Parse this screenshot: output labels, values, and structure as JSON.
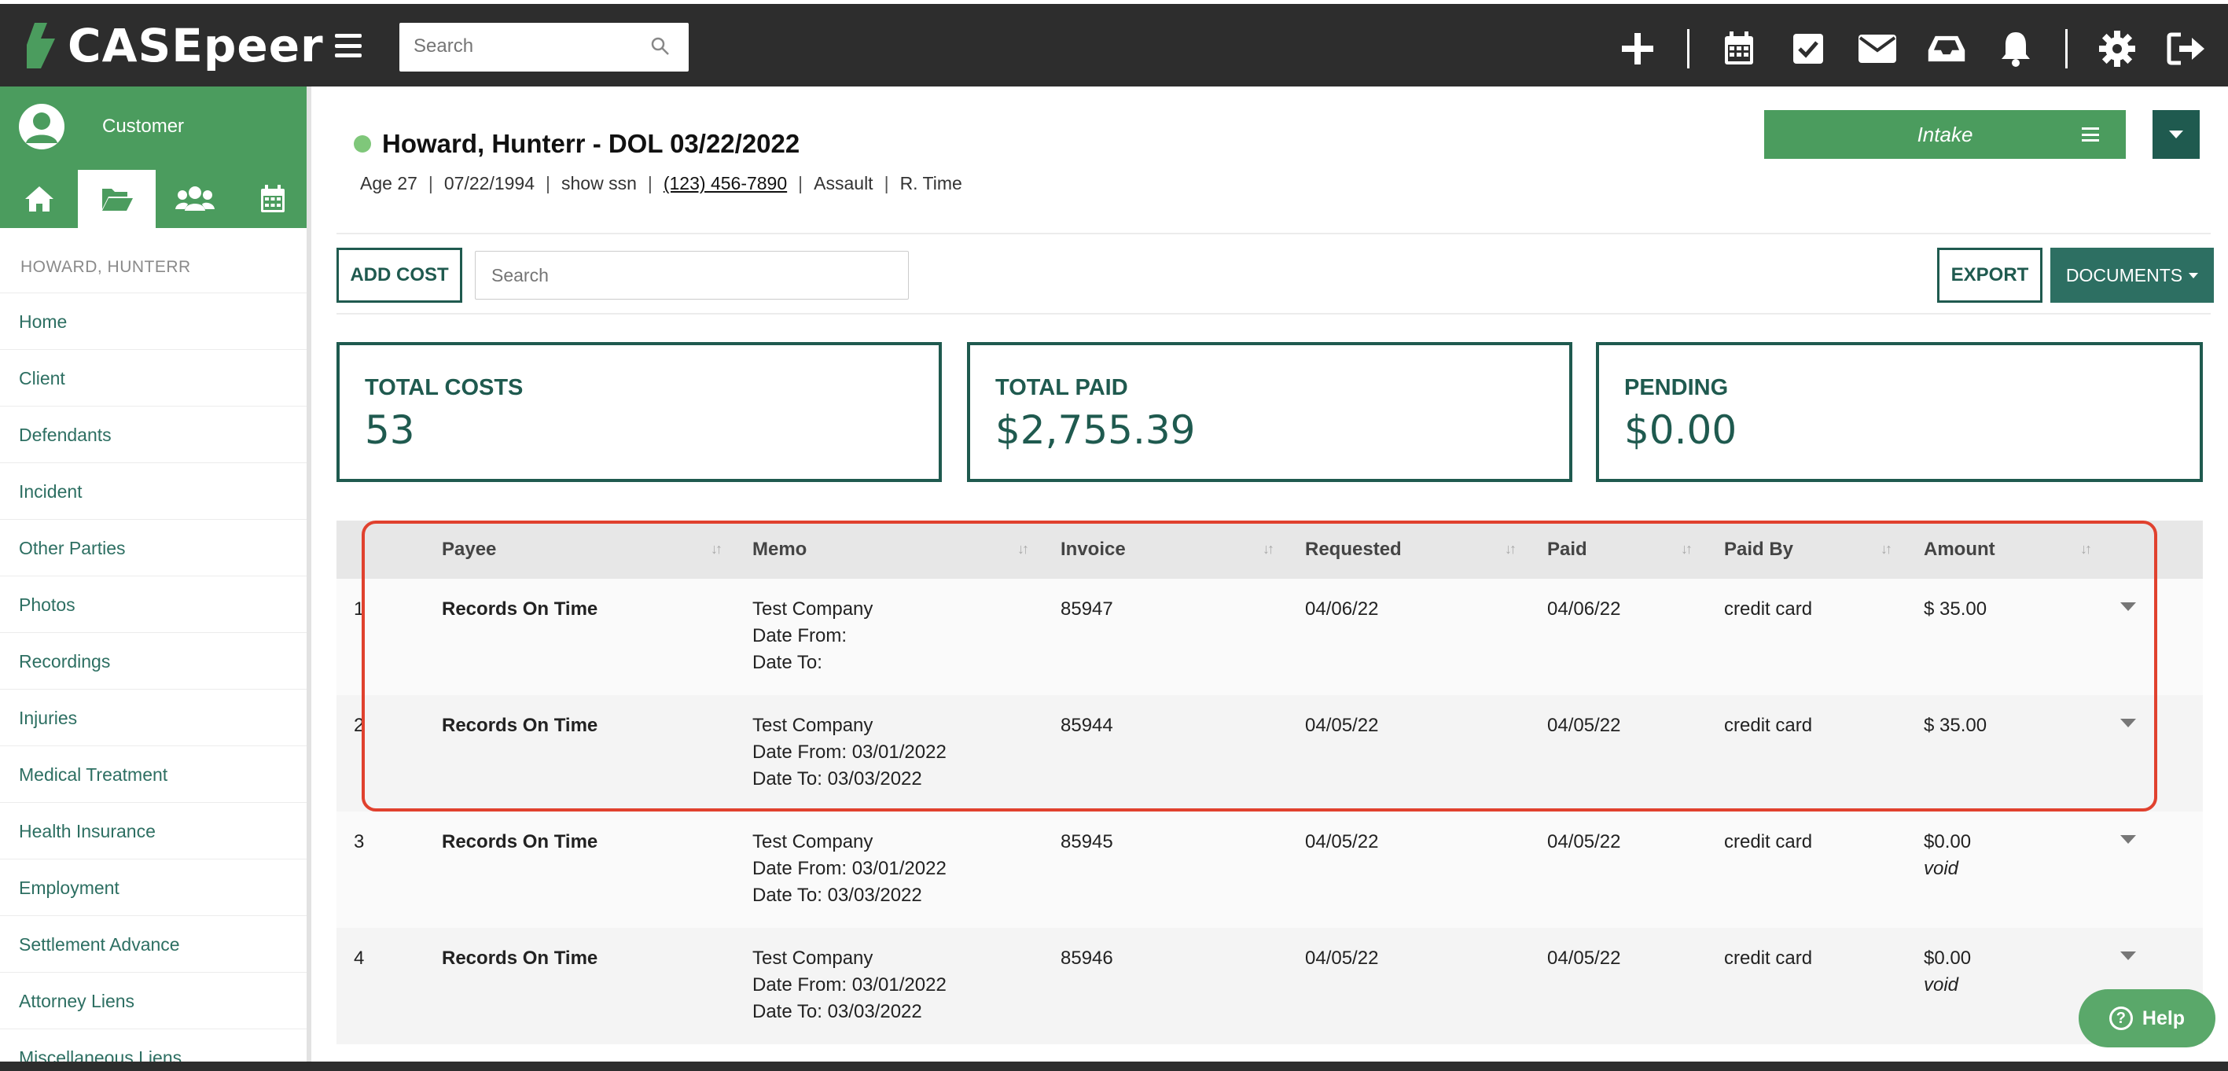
{
  "app": {
    "logo_text": "CASEpeer",
    "search_placeholder": "Search"
  },
  "topbar": {
    "icons": [
      "plus-icon",
      "calendar-icon",
      "checkbox-icon",
      "mail-icon",
      "inbox-icon",
      "bell-icon",
      "gear-icon",
      "logout-icon"
    ]
  },
  "sidebar": {
    "user_name": "Customer",
    "tabs": [
      "home-icon",
      "folder-open-icon",
      "users-icon",
      "calendar-icon"
    ],
    "case_name": "HOWARD, HUNTERR",
    "items": [
      {
        "label": "Home"
      },
      {
        "label": "Client"
      },
      {
        "label": "Defendants"
      },
      {
        "label": "Incident"
      },
      {
        "label": "Other Parties"
      },
      {
        "label": "Photos"
      },
      {
        "label": "Recordings"
      },
      {
        "label": "Injuries"
      },
      {
        "label": "Medical Treatment"
      },
      {
        "label": "Health Insurance"
      },
      {
        "label": "Employment"
      },
      {
        "label": "Settlement Advance"
      },
      {
        "label": "Attorney Liens"
      },
      {
        "label": "Miscellaneous Liens"
      }
    ]
  },
  "case": {
    "title": "Howard, Hunterr - DOL 03/22/2022",
    "status_color": "#7fc77a",
    "age": "Age 27",
    "dob": "07/22/1994",
    "ssn_link": "show ssn",
    "phone": "(123) 456-7890",
    "case_type": "Assault",
    "attorney": "R. Time"
  },
  "stage": {
    "label": "Intake"
  },
  "toolbar": {
    "add_cost_label": "ADD COST",
    "search_placeholder": "Search",
    "export_label": "EXPORT",
    "documents_label": "DOCUMENTS"
  },
  "stats": {
    "total_costs_label": "TOTAL COSTS",
    "total_costs_value": "53",
    "total_paid_label": "TOTAL PAID",
    "total_paid_value": "$2,755.39",
    "pending_label": "PENDING",
    "pending_value": "$0.00"
  },
  "table": {
    "headers": {
      "payee": "Payee",
      "memo": "Memo",
      "invoice": "Invoice",
      "requested": "Requested",
      "paid": "Paid",
      "paid_by": "Paid By",
      "amount": "Amount"
    },
    "rows": [
      {
        "num": "1",
        "payee": "Records On Time",
        "memo1": "Test Company",
        "memo2": "Date From:",
        "memo3": "Date To:",
        "invoice": "85947",
        "requested": "04/06/22",
        "paid": "04/06/22",
        "paid_by": "credit card",
        "amount": "$ 35.00",
        "note": ""
      },
      {
        "num": "2",
        "payee": "Records On Time",
        "memo1": "Test Company",
        "memo2": "Date From: 03/01/2022",
        "memo3": "Date To: 03/03/2022",
        "invoice": "85944",
        "requested": "04/05/22",
        "paid": "04/05/22",
        "paid_by": "credit card",
        "amount": "$ 35.00",
        "note": ""
      },
      {
        "num": "3",
        "payee": "Records On Time",
        "memo1": "Test Company",
        "memo2": "Date From: 03/01/2022",
        "memo3": "Date To: 03/03/2022",
        "invoice": "85945",
        "requested": "04/05/22",
        "paid": "04/05/22",
        "paid_by": "credit card",
        "amount": "$0.00",
        "note": "void"
      },
      {
        "num": "4",
        "payee": "Records On Time",
        "memo1": "Test Company",
        "memo2": "Date From: 03/01/2022",
        "memo3": "Date To: 03/03/2022",
        "invoice": "85946",
        "requested": "04/05/22",
        "paid": "04/05/22",
        "paid_by": "credit card",
        "amount": "$0.00",
        "note": "void"
      }
    ]
  },
  "help": {
    "label": "Help"
  },
  "colors": {
    "brand_green": "#4b9c5e",
    "dark_teal": "#1f5a4f",
    "highlight_red": "#e0412e"
  }
}
